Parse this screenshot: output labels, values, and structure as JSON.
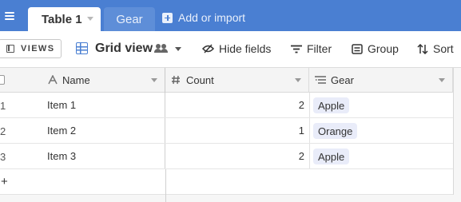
{
  "tabs": {
    "active_label": "Table 1",
    "inactive_label": "Gear",
    "add_label": "Add or import"
  },
  "toolbar": {
    "views_label": "VIEWS",
    "view_name": "Grid view",
    "hide_fields": "Hide fields",
    "filter": "Filter",
    "group": "Group",
    "sort": "Sort"
  },
  "columns": {
    "name": "Name",
    "count": "Count",
    "gear": "Gear"
  },
  "rows": [
    {
      "num": "1",
      "name": "Item 1",
      "count": "2",
      "gear": "Apple"
    },
    {
      "num": "2",
      "name": "Item 2",
      "count": "1",
      "gear": "Orange"
    },
    {
      "num": "3",
      "name": "Item 3",
      "count": "2",
      "gear": "Apple"
    }
  ],
  "add_row": "+",
  "icons": {
    "menu": "menu-icon",
    "add": "plus-square-icon",
    "grid": "grid-icon",
    "people": "collaborators-icon",
    "hide": "eye-slash-icon",
    "filter": "filter-icon",
    "group": "group-icon",
    "sort": "sort-icon",
    "text_field": "text-field-icon",
    "number_field": "hash-icon",
    "link_field": "link-field-icon"
  },
  "colors": {
    "header_blue": "#4a7fd2",
    "pill_bg": "#e9ecf9"
  }
}
